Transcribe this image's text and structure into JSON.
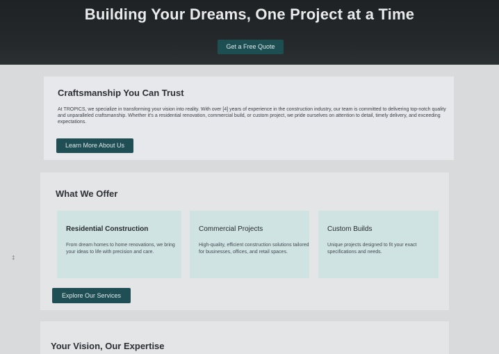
{
  "hero": {
    "title": "Building Your Dreams, One Project at a Time",
    "cta_label": "Get a Free Quote"
  },
  "about": {
    "heading": "Craftsmanship You Can Trust",
    "body": "At TROPICS, we specialize in transforming your vision into reality. With over [4] years of experience in the construction industry, our team is committed to delivering top-notch quality and unparalleled craftsmanship. Whether it's a residential renovation, commercial build, or custom project, we pride ourselves on attention to detail, timely delivery, and exceeding expectations.",
    "button_label": "Learn More About Us"
  },
  "services": {
    "heading": "What We Offer",
    "items": [
      {
        "title": "Residential Construction",
        "description": "From dream homes to home renovations, we bring your ideas to life with precision and care."
      },
      {
        "title": "Commercial Projects",
        "description": "High-quality, efficient construction solutions tailored for businesses, offices, and retail spaces."
      },
      {
        "title": "Custom Builds",
        "description": "Unique projects designed to fit your exact specifications and needs."
      }
    ],
    "button_label": "Explore Our Services"
  },
  "vision": {
    "heading": "Your Vision, Our Expertise"
  },
  "margin_mark": "‡"
}
